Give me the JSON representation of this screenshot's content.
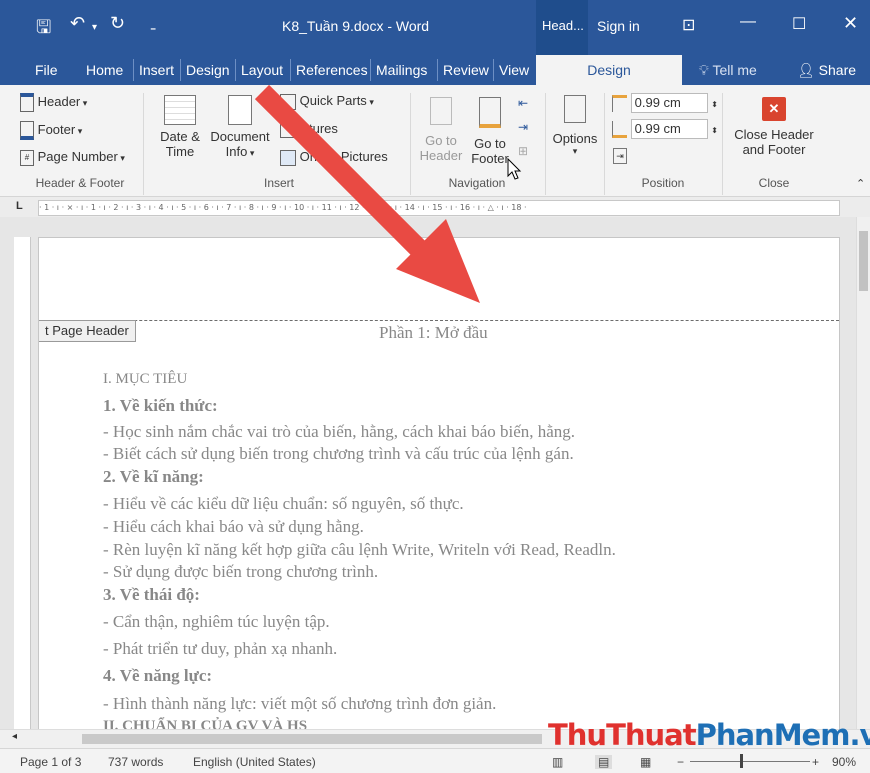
{
  "titlebar": {
    "file_name": "K8_Tuần 9.docx - Word",
    "context_tab": "Head...",
    "sign_in": "Sign in",
    "accent": "#2b579a"
  },
  "tabs": {
    "items": [
      "File",
      "Home",
      "Insert",
      "Design",
      "Layout",
      "References",
      "Mailings",
      "Review",
      "View"
    ],
    "active": "Design",
    "tell_me": "Tell me",
    "share": "Share"
  },
  "ribbon": {
    "header": "Header",
    "footer": "Footer",
    "page_number": "Page Number",
    "group_header_footer": "Header & Footer",
    "date_time": [
      "Date &",
      "Time"
    ],
    "document_info": [
      "Document",
      "Info"
    ],
    "quick_parts": "Quick Parts",
    "pictures": "ictures",
    "online_pictures": "Online Pictures",
    "group_insert": "Insert",
    "goto_header": [
      "Go to",
      "Header"
    ],
    "goto_footer": [
      "Go to",
      "Footer"
    ],
    "group_navigation": "Navigation",
    "options": "Options",
    "header_pos": "0.99 cm",
    "footer_pos": "0.99 cm",
    "group_position": "Position",
    "close_header_footer": [
      "Close Header",
      "and Footer"
    ],
    "group_close": "Close"
  },
  "ruler_text": "· 1 · ı · ⨯ · ı · 1 · ı · 2 · ı · 3 · ı · 4 · ı · 5 · ı · 6 · ı · 7 · ı · 8 · ı · 9 · ı · 10 · ı · 11 · ı · 12 · ı · 13 · ı · 14 · ı · 15 · ı · 16 · ı · △ · ı · 18 ·",
  "document": {
    "header_tag": "t Page Header",
    "header_text": "Phần 1: Mở đầu",
    "lines": [
      "I. MỤC TIÊU",
      "1. Về kiến thức:",
      "- Học sinh nắm chắc vai trò của biến, hằng, cách khai báo biến, hằng.",
      "- Biết cách sử dụng biến trong chương trình và cấu trúc của lệnh gán.",
      "2. Về kĩ năng:",
      "- Hiểu về các kiểu dữ liệu chuẩn: số nguyên, số thực.",
      "- Hiểu cách khai báo và sử dụng hằng.",
      "- Rèn luyện kĩ năng kết hợp giữa câu lệnh Write, Writeln với Read, Readln.",
      "- Sử dụng được biến trong chương trình.",
      "3. Về thái độ:",
      "- Cẩn thận, nghiêm túc luyện tập.",
      "- Phát triển tư duy, phản xạ nhanh.",
      "4. Về năng lực:",
      "- Hình thành năng lực: viết một số chương trình đơn giản.",
      "II. CHUẨN BỊ CỦA GV VÀ HS"
    ]
  },
  "status": {
    "page": "Page 1 of 3",
    "words": "737 words",
    "language": "English (United States)",
    "zoom": "90%"
  },
  "watermark": {
    "part1": "ThuThuat",
    "part2": "PhanMem",
    "part3": ".vn",
    "color1": "#e0312e",
    "color2": "#1e6fb5"
  }
}
